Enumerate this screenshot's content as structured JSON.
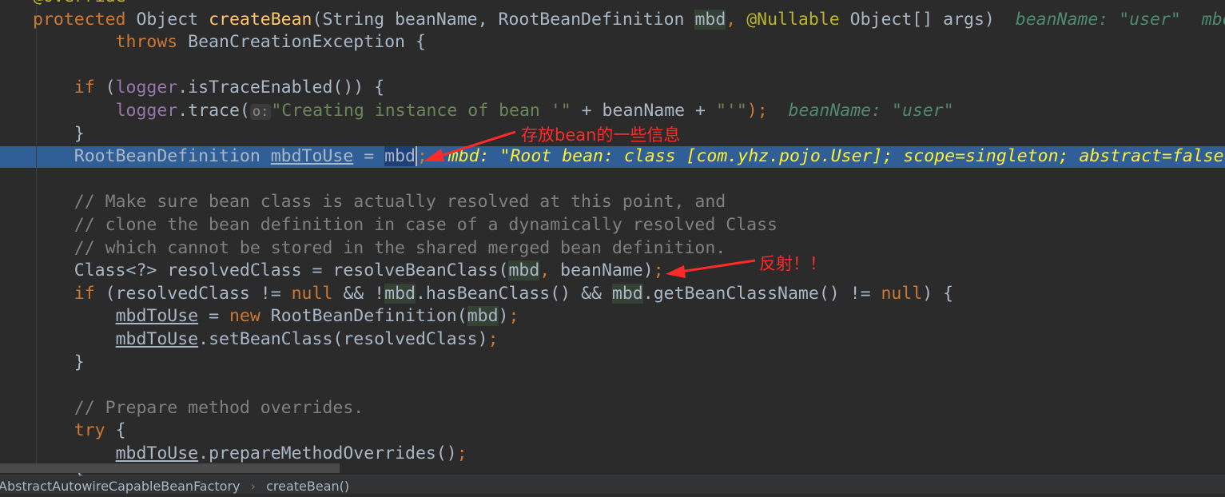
{
  "editor": {
    "lines": [
      [
        {
          "t": "@Override",
          "c": "ann"
        }
      ],
      [
        {
          "t": "protected ",
          "c": "kw"
        },
        {
          "t": "Object ",
          "c": ""
        },
        {
          "t": "createBean",
          "c": "decl"
        },
        {
          "t": "(String beanName, RootBeanDefinition ",
          "c": ""
        },
        {
          "t": "mbd",
          "c": "mbd"
        },
        {
          "t": ", ",
          "c": "kw"
        },
        {
          "t": "@Nullable ",
          "c": "ann"
        },
        {
          "t": "Object[] args)  ",
          "c": ""
        },
        {
          "t": "beanName: \"user\"  mbd",
          "c": "hint"
        }
      ],
      [
        {
          "t": "        throws ",
          "c": "kw"
        },
        {
          "t": "BeanCreationException {",
          "c": ""
        }
      ],
      [],
      [
        {
          "t": "    if ",
          "c": "kw"
        },
        {
          "t": "(",
          "c": ""
        },
        {
          "t": "logger",
          "c": "field"
        },
        {
          "t": ".isTraceEnabled()) {",
          "c": ""
        }
      ],
      [
        {
          "t": "        ",
          "c": ""
        },
        {
          "t": "logger",
          "c": "field"
        },
        {
          "t": ".trace(",
          "c": ""
        },
        {
          "t": "o:",
          "c": "pbox"
        },
        {
          "t": "\"Creating instance of bean '\"",
          "c": "str"
        },
        {
          "t": " + beanName + ",
          "c": ""
        },
        {
          "t": "\"'\"",
          "c": "str"
        },
        {
          "t": ");",
          "c": "semi"
        },
        {
          "t": "  beanName: \"user\"",
          "c": "hint"
        }
      ],
      [
        {
          "t": "    }",
          "c": ""
        }
      ],
      [
        {
          "t": "    RootBeanDefinition ",
          "c": ""
        },
        {
          "t": "mbdToUse",
          "c": "ul"
        },
        {
          "t": " = ",
          "c": ""
        },
        {
          "t": "mbd",
          "c": "mbdsel"
        },
        {
          "t": ";",
          "c": "semi caret"
        },
        {
          "t": "  mbd: \"Root bean: class [com.yhz.pojo.User]; scope=singleton; abstract=false",
          "c": "hintsel"
        }
      ],
      [],
      [
        {
          "t": "    // Make sure bean class is actually resolved at this point, and",
          "c": "cm"
        }
      ],
      [
        {
          "t": "    // clone the bean definition in case of a dynamically resolved Class",
          "c": "cm"
        }
      ],
      [
        {
          "t": "    // which cannot be stored in the shared merged bean definition.",
          "c": "cm"
        }
      ],
      [
        {
          "t": "    Class<?> resolvedClass = resolveBeanClass(",
          "c": ""
        },
        {
          "t": "mbd",
          "c": "mbd"
        },
        {
          "t": ", ",
          "c": "kw"
        },
        {
          "t": "beanName)",
          "c": ""
        },
        {
          "t": ";",
          "c": "semi"
        }
      ],
      [
        {
          "t": "    if ",
          "c": "kw"
        },
        {
          "t": "(resolvedClass != ",
          "c": ""
        },
        {
          "t": "null ",
          "c": "kw"
        },
        {
          "t": "&& !",
          "c": ""
        },
        {
          "t": "mbd",
          "c": "mbd"
        },
        {
          "t": ".hasBeanClass() && ",
          "c": ""
        },
        {
          "t": "mbd",
          "c": "mbd"
        },
        {
          "t": ".getBeanClassName() != ",
          "c": ""
        },
        {
          "t": "null",
          "c": "kw"
        },
        {
          "t": ") {",
          "c": ""
        }
      ],
      [
        {
          "t": "        ",
          "c": ""
        },
        {
          "t": "mbdToUse",
          "c": "ul"
        },
        {
          "t": " = ",
          "c": ""
        },
        {
          "t": "new ",
          "c": "kw"
        },
        {
          "t": "RootBeanDefinition(",
          "c": ""
        },
        {
          "t": "mbd",
          "c": "mbd"
        },
        {
          "t": ")",
          "c": ""
        },
        {
          "t": ";",
          "c": "semi"
        }
      ],
      [
        {
          "t": "        ",
          "c": ""
        },
        {
          "t": "mbdToUse",
          "c": "ul"
        },
        {
          "t": ".setBeanClass(resolvedClass)",
          "c": ""
        },
        {
          "t": ";",
          "c": "semi"
        }
      ],
      [
        {
          "t": "    }",
          "c": ""
        }
      ],
      [],
      [
        {
          "t": "    // Prepare method overrides.",
          "c": "cm"
        }
      ],
      [
        {
          "t": "    try ",
          "c": "kw"
        },
        {
          "t": "{",
          "c": ""
        }
      ],
      [
        {
          "t": "        ",
          "c": ""
        },
        {
          "t": "mbdToUse",
          "c": "ul"
        },
        {
          "t": ".prepareMethodOverrides()",
          "c": ""
        },
        {
          "t": ";",
          "c": "semi"
        }
      ],
      [
        {
          "t": "    }",
          "c": ""
        }
      ]
    ]
  },
  "annotations": {
    "note1": "存放bean的一些信息",
    "note2": "反射！！",
    "color": "#FF2A2A"
  },
  "breadcrumb": {
    "class_name": "AbstractAutowireCapableBeanFactory",
    "separator": "›",
    "method": "createBean()"
  }
}
